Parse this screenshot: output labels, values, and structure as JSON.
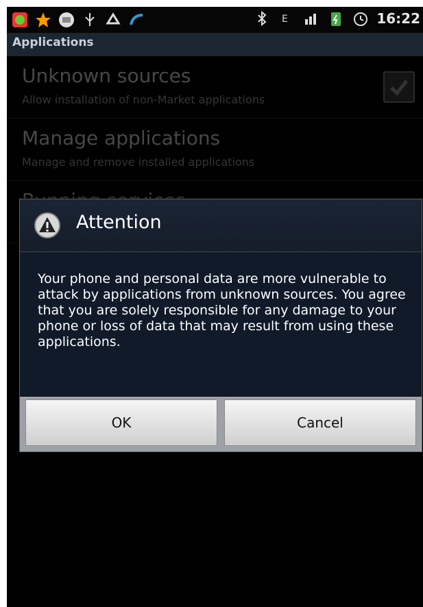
{
  "status_bar": {
    "time": "16:22",
    "icons": [
      "app-icon",
      "star-icon",
      "message-icon",
      "usb-icon",
      "recycle-icon",
      "sync-icon",
      "bluetooth-icon",
      "data-icon",
      "signal-icon",
      "battery-icon",
      "alarm-icon"
    ]
  },
  "title": "Applications",
  "list": {
    "items": [
      {
        "title": "Unknown sources",
        "subtitle": "Allow installation of non-Market applications"
      },
      {
        "title": "Manage applications",
        "subtitle": "Manage and remove installed applications"
      },
      {
        "title": "Running services",
        "subtitle": ""
      }
    ]
  },
  "dialog": {
    "title": "Attention",
    "message": "Your phone and personal data are more vulnerable to attack by applications from unknown sources. You agree that you are solely responsible for any damage to your phone or loss of data that may result from using these applications.",
    "ok_label": "OK",
    "cancel_label": "Cancel"
  },
  "colors": {
    "title_bar": "#1b2633",
    "dialog_header": "#1a2434",
    "dialog_body": "#101a28",
    "button_face": "#e6e6e6"
  }
}
